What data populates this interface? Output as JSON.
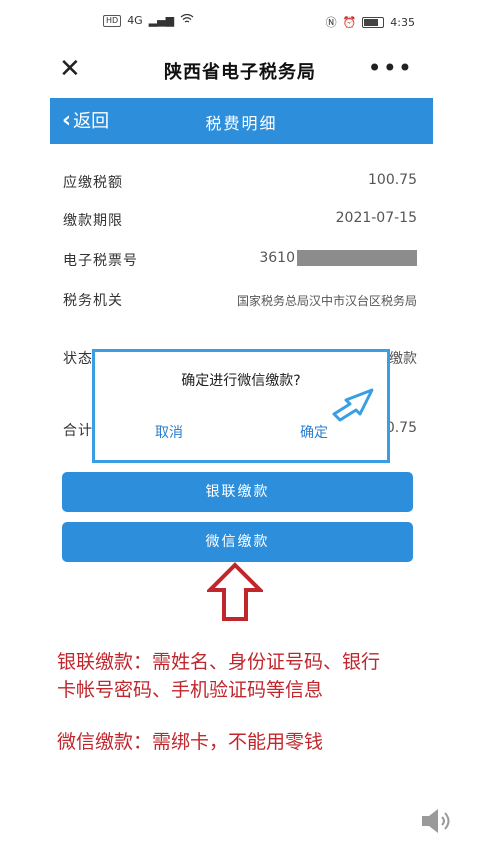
{
  "status_bar": {
    "left_badges": [
      "HD",
      "4G"
    ],
    "time": "4:35"
  },
  "titlebar": {
    "close_glyph": "✕",
    "title": "陕西省电子税务局",
    "more_glyph": "•••"
  },
  "nav": {
    "back_label": "返回",
    "title": "税费明细"
  },
  "details": {
    "tax_amount_label": "应缴税额",
    "tax_amount_value": "100.75",
    "deadline_label": "缴款期限",
    "deadline_value": "2021-07-15",
    "ticket_label": "电子税票号",
    "ticket_value_prefix": "3610",
    "authority_label": "税务机关",
    "authority_value": "国家税务总局汉中市汉台区税务局",
    "status_label_partial": "状态",
    "status_value_partial": "缴款",
    "total_label_partial": "合计",
    "total_value_partial": "0.75"
  },
  "dialog": {
    "message": "确定进行微信缴款?",
    "cancel": "取消",
    "confirm": "确定"
  },
  "buttons": {
    "unionpay": "银联缴款",
    "wechat": "微信缴款"
  },
  "annotations": {
    "line1": "银联缴款：需姓名、身份证号码、银行",
    "line2": "卡帐号密码、手机验证码等信息",
    "line3": "微信缴款：需绑卡，不能用零钱"
  },
  "colors": {
    "primary_blue": "#2d8fdc",
    "dialog_border": "#3a9fe2",
    "annotation_red": "#c0272d"
  }
}
